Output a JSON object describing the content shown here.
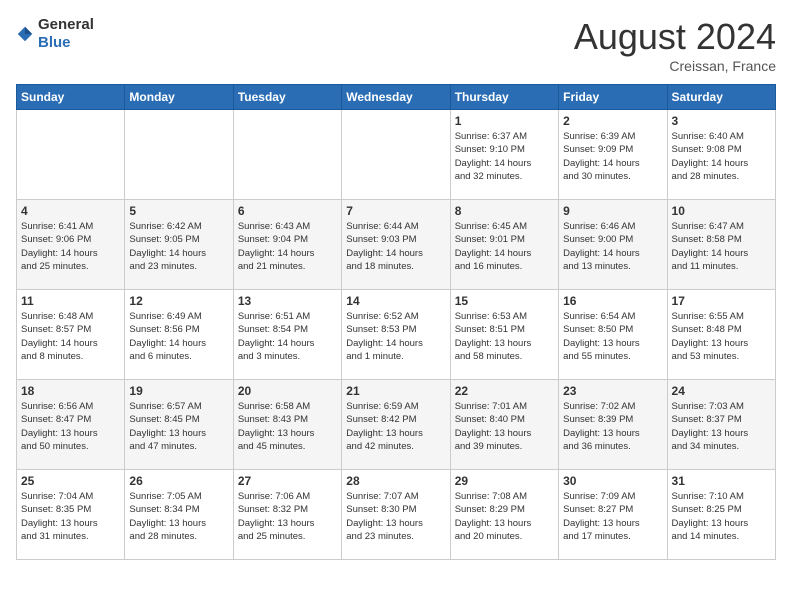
{
  "header": {
    "logo": {
      "text_general": "General",
      "text_blue": "Blue"
    },
    "title": "August 2024",
    "location": "Creissan, France"
  },
  "days_of_week": [
    "Sunday",
    "Monday",
    "Tuesday",
    "Wednesday",
    "Thursday",
    "Friday",
    "Saturday"
  ],
  "weeks": [
    [
      {
        "day": "",
        "info": ""
      },
      {
        "day": "",
        "info": ""
      },
      {
        "day": "",
        "info": ""
      },
      {
        "day": "",
        "info": ""
      },
      {
        "day": "1",
        "info": "Sunrise: 6:37 AM\nSunset: 9:10 PM\nDaylight: 14 hours\nand 32 minutes."
      },
      {
        "day": "2",
        "info": "Sunrise: 6:39 AM\nSunset: 9:09 PM\nDaylight: 14 hours\nand 30 minutes."
      },
      {
        "day": "3",
        "info": "Sunrise: 6:40 AM\nSunset: 9:08 PM\nDaylight: 14 hours\nand 28 minutes."
      }
    ],
    [
      {
        "day": "4",
        "info": "Sunrise: 6:41 AM\nSunset: 9:06 PM\nDaylight: 14 hours\nand 25 minutes."
      },
      {
        "day": "5",
        "info": "Sunrise: 6:42 AM\nSunset: 9:05 PM\nDaylight: 14 hours\nand 23 minutes."
      },
      {
        "day": "6",
        "info": "Sunrise: 6:43 AM\nSunset: 9:04 PM\nDaylight: 14 hours\nand 21 minutes."
      },
      {
        "day": "7",
        "info": "Sunrise: 6:44 AM\nSunset: 9:03 PM\nDaylight: 14 hours\nand 18 minutes."
      },
      {
        "day": "8",
        "info": "Sunrise: 6:45 AM\nSunset: 9:01 PM\nDaylight: 14 hours\nand 16 minutes."
      },
      {
        "day": "9",
        "info": "Sunrise: 6:46 AM\nSunset: 9:00 PM\nDaylight: 14 hours\nand 13 minutes."
      },
      {
        "day": "10",
        "info": "Sunrise: 6:47 AM\nSunset: 8:58 PM\nDaylight: 14 hours\nand 11 minutes."
      }
    ],
    [
      {
        "day": "11",
        "info": "Sunrise: 6:48 AM\nSunset: 8:57 PM\nDaylight: 14 hours\nand 8 minutes."
      },
      {
        "day": "12",
        "info": "Sunrise: 6:49 AM\nSunset: 8:56 PM\nDaylight: 14 hours\nand 6 minutes."
      },
      {
        "day": "13",
        "info": "Sunrise: 6:51 AM\nSunset: 8:54 PM\nDaylight: 14 hours\nand 3 minutes."
      },
      {
        "day": "14",
        "info": "Sunrise: 6:52 AM\nSunset: 8:53 PM\nDaylight: 14 hours\nand 1 minute."
      },
      {
        "day": "15",
        "info": "Sunrise: 6:53 AM\nSunset: 8:51 PM\nDaylight: 13 hours\nand 58 minutes."
      },
      {
        "day": "16",
        "info": "Sunrise: 6:54 AM\nSunset: 8:50 PM\nDaylight: 13 hours\nand 55 minutes."
      },
      {
        "day": "17",
        "info": "Sunrise: 6:55 AM\nSunset: 8:48 PM\nDaylight: 13 hours\nand 53 minutes."
      }
    ],
    [
      {
        "day": "18",
        "info": "Sunrise: 6:56 AM\nSunset: 8:47 PM\nDaylight: 13 hours\nand 50 minutes."
      },
      {
        "day": "19",
        "info": "Sunrise: 6:57 AM\nSunset: 8:45 PM\nDaylight: 13 hours\nand 47 minutes."
      },
      {
        "day": "20",
        "info": "Sunrise: 6:58 AM\nSunset: 8:43 PM\nDaylight: 13 hours\nand 45 minutes."
      },
      {
        "day": "21",
        "info": "Sunrise: 6:59 AM\nSunset: 8:42 PM\nDaylight: 13 hours\nand 42 minutes."
      },
      {
        "day": "22",
        "info": "Sunrise: 7:01 AM\nSunset: 8:40 PM\nDaylight: 13 hours\nand 39 minutes."
      },
      {
        "day": "23",
        "info": "Sunrise: 7:02 AM\nSunset: 8:39 PM\nDaylight: 13 hours\nand 36 minutes."
      },
      {
        "day": "24",
        "info": "Sunrise: 7:03 AM\nSunset: 8:37 PM\nDaylight: 13 hours\nand 34 minutes."
      }
    ],
    [
      {
        "day": "25",
        "info": "Sunrise: 7:04 AM\nSunset: 8:35 PM\nDaylight: 13 hours\nand 31 minutes."
      },
      {
        "day": "26",
        "info": "Sunrise: 7:05 AM\nSunset: 8:34 PM\nDaylight: 13 hours\nand 28 minutes."
      },
      {
        "day": "27",
        "info": "Sunrise: 7:06 AM\nSunset: 8:32 PM\nDaylight: 13 hours\nand 25 minutes."
      },
      {
        "day": "28",
        "info": "Sunrise: 7:07 AM\nSunset: 8:30 PM\nDaylight: 13 hours\nand 23 minutes."
      },
      {
        "day": "29",
        "info": "Sunrise: 7:08 AM\nSunset: 8:29 PM\nDaylight: 13 hours\nand 20 minutes."
      },
      {
        "day": "30",
        "info": "Sunrise: 7:09 AM\nSunset: 8:27 PM\nDaylight: 13 hours\nand 17 minutes."
      },
      {
        "day": "31",
        "info": "Sunrise: 7:10 AM\nSunset: 8:25 PM\nDaylight: 13 hours\nand 14 minutes."
      }
    ]
  ]
}
